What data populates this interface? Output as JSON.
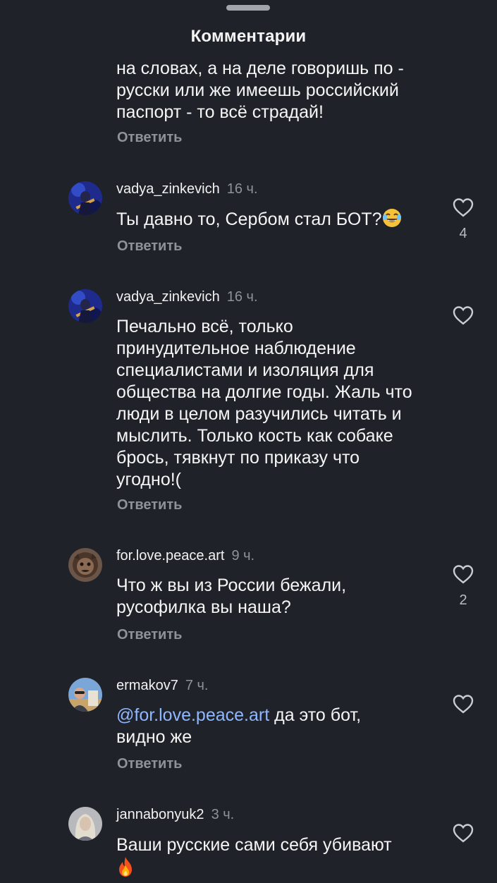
{
  "header": {
    "title": "Комментарии"
  },
  "reply_label": "Ответить",
  "partial_comment": {
    "lines": [
      "на словах, а на деле говоришь по -",
      "русски или же имеешь российский",
      "паспорт - то всё страдай!"
    ]
  },
  "comments": [
    {
      "username": "vadya_zinkevich",
      "time": "16 ч.",
      "text": "Ты давно то, Сербом стал БОТ?",
      "emoji": "laughing-tears-emoji",
      "likes": "4"
    },
    {
      "username": "vadya_zinkevich",
      "time": "16 ч.",
      "lines": [
        "Печально всё, только",
        "принудительное наблюдение",
        "специалистами и изоляция для",
        "общества на долгие годы. Жаль что",
        "люди в целом разучились читать и",
        "мыслить. Только кость как собаке",
        "брось, тявкнут по приказу что",
        "угодно!("
      ]
    },
    {
      "username": "for.love.peace.art",
      "time": "9 ч.",
      "lines": [
        "Что ж вы из России бежали,",
        "русофилка вы наша?"
      ],
      "likes": "2"
    },
    {
      "username": "ermakov7",
      "time": "7 ч.",
      "mention": "@for.love.peace.art",
      "line1_rest": " да это бот,",
      "line2": "видно же"
    },
    {
      "username": "jannabonyuk2",
      "time": "3 ч.",
      "text": "Ваши русские сами себя убивают",
      "emoji": "fire-emoji"
    }
  ],
  "colors": {
    "background": "#1f2228",
    "text": "#f5f5f6",
    "secondary": "#8e9299",
    "mention": "#8fb7ff"
  }
}
